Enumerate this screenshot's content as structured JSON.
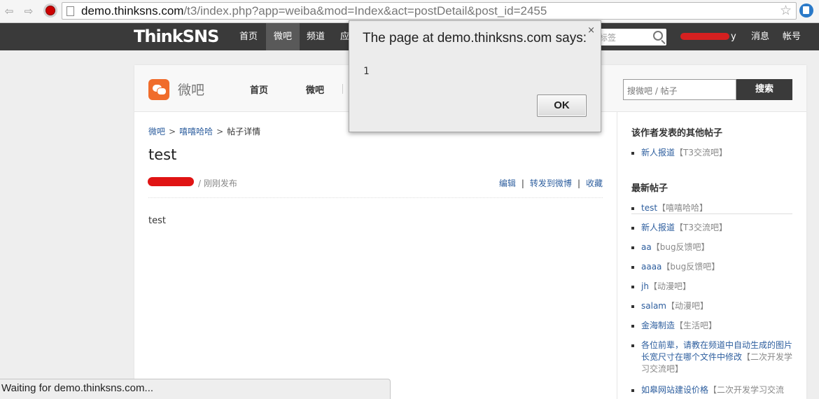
{
  "browser": {
    "url_host": "demo.thinksns.com",
    "url_path": "/t3/index.php?app=weiba&mod=Index&act=postDetail&post_id=2455",
    "status_text": "Waiting for demo.thinksns.com..."
  },
  "header": {
    "logo": "ThinkSNS",
    "nav": [
      "首页",
      "微吧",
      "频道",
      "应"
    ],
    "search_placeholder": "标签",
    "user_suffix": "y",
    "links": [
      "消息",
      "帐号"
    ]
  },
  "weiba": {
    "title": "微吧",
    "subnav": [
      "首页",
      "微吧"
    ],
    "search_placeholder": "搜微吧 / 帖子",
    "search_button": "搜索"
  },
  "post": {
    "breadcrumb": [
      "微吧",
      "嘻嘻哈哈",
      "帖子详情"
    ],
    "breadcrumb_sep": ">",
    "title": "test",
    "meta": "/ 刚刚发布",
    "actions": [
      "编辑",
      "转发到微博",
      "收藏"
    ],
    "action_sep": "|",
    "body": "test"
  },
  "sidebar": {
    "other_posts_heading": "该作者发表的其他帖子",
    "other_posts": [
      {
        "title": "新人报道",
        "tag": "【T3交流吧】"
      }
    ],
    "latest_heading": "最新帖子",
    "latest": [
      {
        "title": "test",
        "tag": "【嘻嘻哈哈】"
      },
      {
        "title": "新人报道",
        "tag": "【T3交流吧】"
      },
      {
        "title": "aa",
        "tag": "【bug反馈吧】"
      },
      {
        "title": "aaaa",
        "tag": "【bug反馈吧】"
      },
      {
        "title": "jh",
        "tag": "【动漫吧】"
      },
      {
        "title": "salam",
        "tag": "【动漫吧】"
      },
      {
        "title": "金海制造",
        "tag": "【生活吧】"
      },
      {
        "title": "各位前辈，请教在频道中自动生成的图片长宽尺寸在哪个文件中修改",
        "tag": "【二次开发学习交流吧】"
      },
      {
        "title": "如皋网站建设价格",
        "tag": "【二次开发学习交流"
      }
    ]
  },
  "alert": {
    "title": "The page at demo.thinksns.com says:",
    "message": "1",
    "ok_label": "OK",
    "close_label": "×"
  },
  "colors": {
    "header_bg": "#3a3a3a",
    "link": "#2d5e9e",
    "accent": "#f06c2b"
  }
}
